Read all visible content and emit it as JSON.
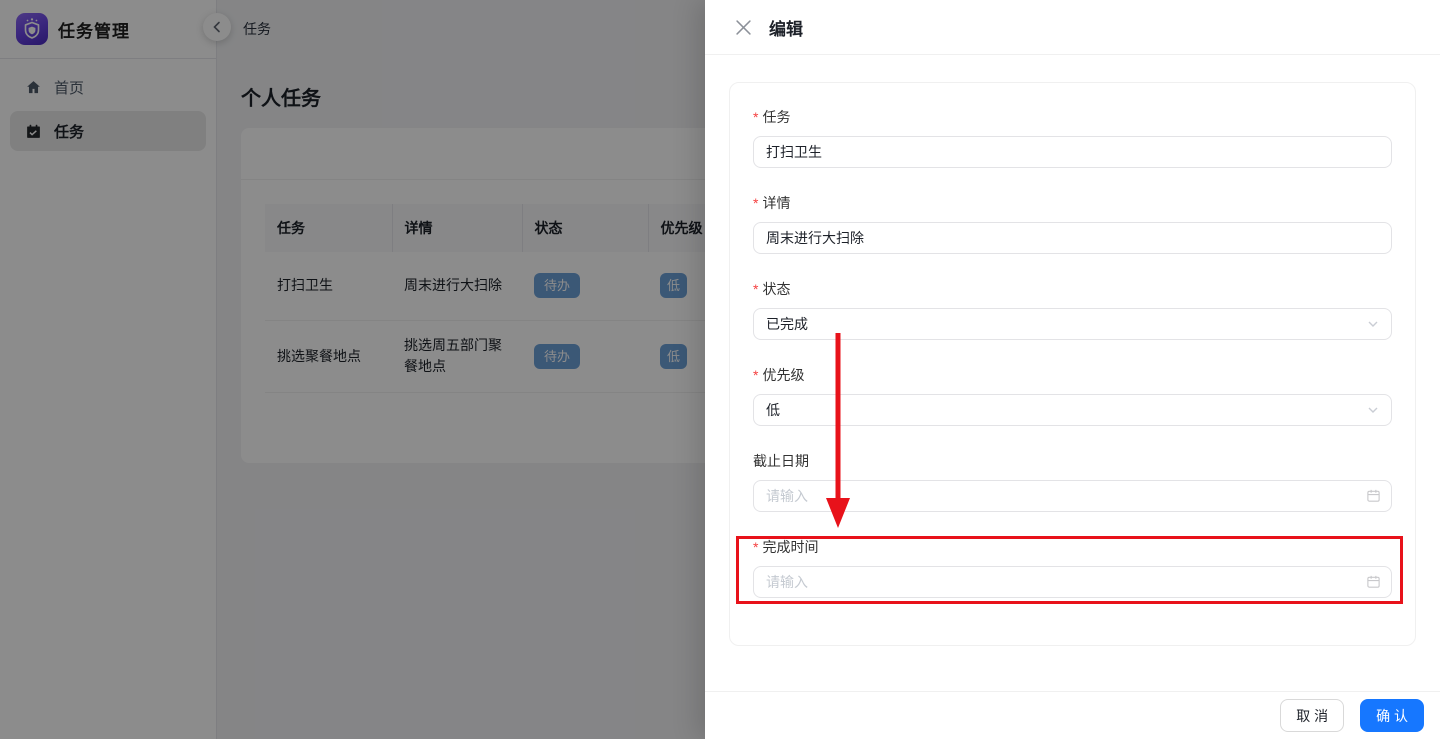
{
  "app": {
    "title": "任务管理",
    "breadcrumb": "任务"
  },
  "sidebar": {
    "items": [
      {
        "label": "首页",
        "icon": "home-icon",
        "active": false
      },
      {
        "label": "任务",
        "icon": "calendar-check-icon",
        "active": true
      }
    ]
  },
  "main": {
    "page_title": "个人任务",
    "table": {
      "columns": [
        "任务",
        "详情",
        "状态",
        "优先级"
      ],
      "rows": [
        {
          "task": "打扫卫生",
          "detail": "周末进行大扫除",
          "status": "待办",
          "priority": "低"
        },
        {
          "task": "挑选聚餐地点",
          "detail": "挑选周五部门聚餐地点",
          "status": "待办",
          "priority": "低"
        }
      ]
    }
  },
  "drawer": {
    "title": "编辑",
    "required_marker": "*",
    "fields": [
      {
        "label": "任务",
        "required": true,
        "type": "text",
        "value": "打扫卫生"
      },
      {
        "label": "详情",
        "required": true,
        "type": "text",
        "value": "周末进行大扫除"
      },
      {
        "label": "状态",
        "required": true,
        "type": "select",
        "value": "已完成"
      },
      {
        "label": "优先级",
        "required": true,
        "type": "select",
        "value": "低"
      },
      {
        "label": "截止日期",
        "required": false,
        "type": "date",
        "placeholder": "请输入"
      },
      {
        "label": "完成时间",
        "required": true,
        "type": "date",
        "placeholder": "请输入",
        "highlighted": true
      }
    ],
    "footer": {
      "cancel_label": "取 消",
      "confirm_label": "确 认"
    }
  },
  "annotation": {
    "type": "arrow-and-box",
    "color": "#e8121a",
    "target_field": "完成时间"
  },
  "colors": {
    "primary": "#1677ff",
    "badge_blue": "#6ca0d8",
    "annotation_red": "#e8121a",
    "mask": "rgba(0,0,0,0.45)"
  }
}
